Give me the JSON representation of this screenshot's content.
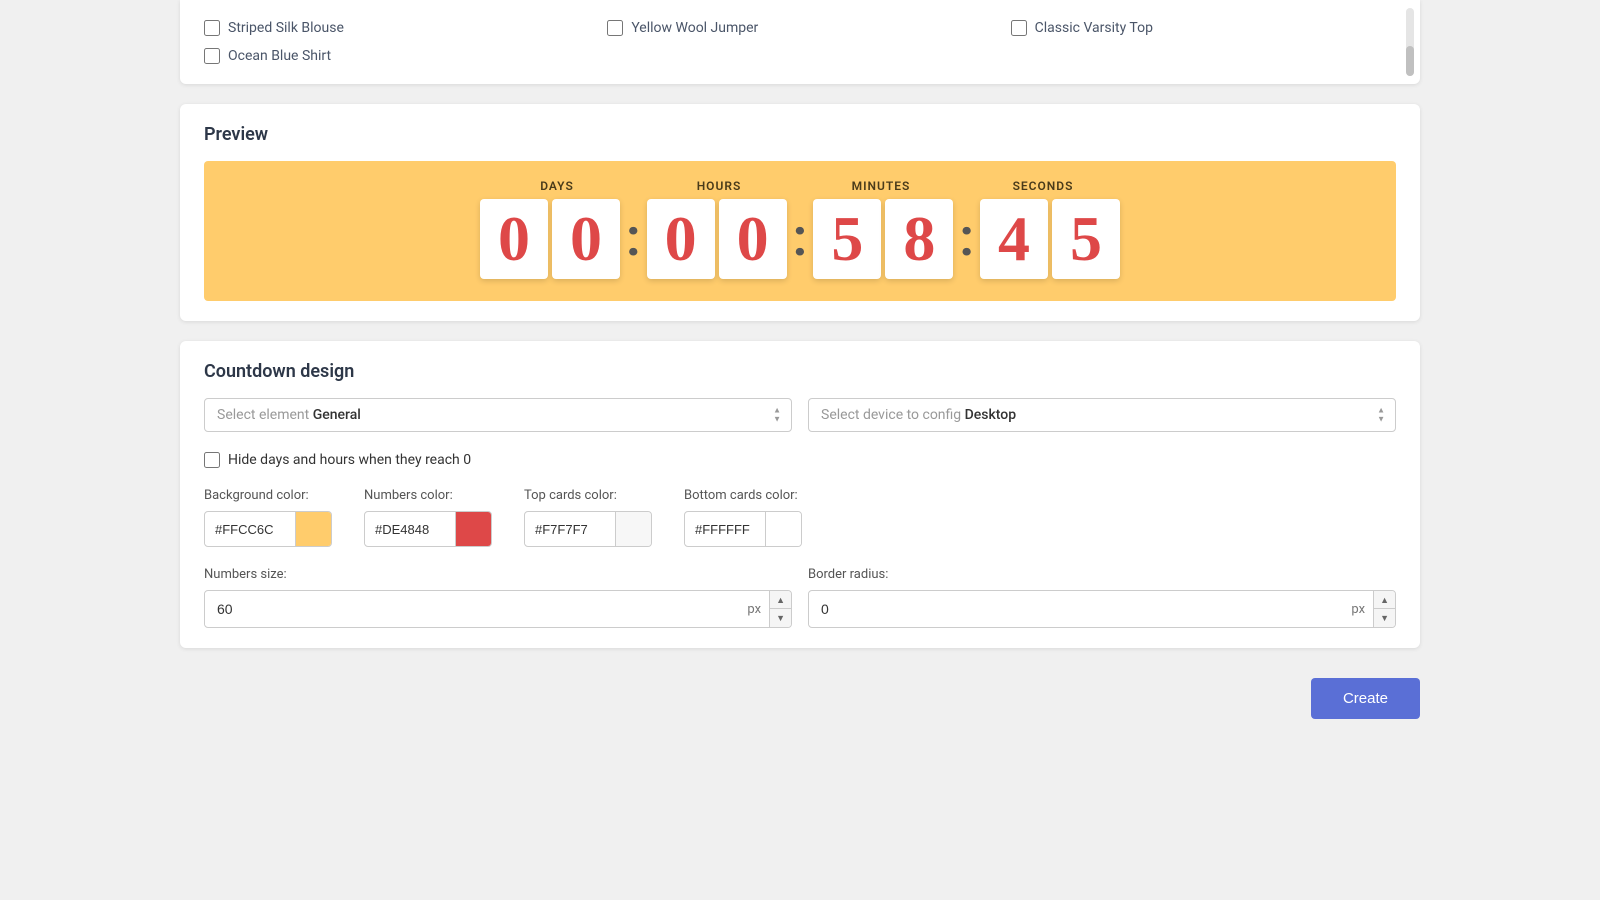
{
  "products": {
    "items": [
      {
        "id": "striped-silk-blouse",
        "label": "Striped Silk Blouse",
        "checked": false
      },
      {
        "id": "yellow-wool-jumper",
        "label": "Yellow Wool Jumper",
        "checked": false
      },
      {
        "id": "classic-varsity-top",
        "label": "Classic Varsity Top",
        "checked": false
      },
      {
        "id": "ocean-blue-shirt",
        "label": "Ocean Blue Shirt",
        "checked": false
      }
    ]
  },
  "preview": {
    "title": "Preview",
    "labels": {
      "days": "DAYS",
      "hours": "HOURS",
      "minutes": "MINUTES",
      "seconds": "SECONDS"
    },
    "digits": {
      "days": [
        "0",
        "0"
      ],
      "hours": [
        "0",
        "0"
      ],
      "minutes": [
        "5",
        "8"
      ],
      "seconds": [
        "4",
        "5"
      ]
    }
  },
  "design": {
    "title": "Countdown design",
    "element_select": {
      "label": "Select element",
      "value": "General"
    },
    "device_select": {
      "label": "Select device to config",
      "value": "Desktop"
    },
    "hide_checkbox": {
      "label": "Hide days and hours when they reach 0",
      "checked": false
    },
    "bg_color": {
      "label": "Background color:",
      "hex": "#FFCC6C",
      "swatch": "#FFCC6C"
    },
    "numbers_color": {
      "label": "Numbers color:",
      "hex": "#DE4848",
      "swatch": "#DE4848"
    },
    "top_cards_color": {
      "label": "Top cards color:",
      "hex": "#F7F7F7",
      "swatch": "#F7F7F7"
    },
    "bottom_cards_color": {
      "label": "Bottom cards color:",
      "hex": "#FFFFFF",
      "swatch": "#FFFFFF"
    },
    "numbers_size": {
      "label": "Numbers size:",
      "value": "60",
      "unit": "px"
    },
    "border_radius": {
      "label": "Border radius:",
      "value": "0",
      "unit": "px"
    }
  },
  "footer": {
    "create_button": "Create"
  }
}
